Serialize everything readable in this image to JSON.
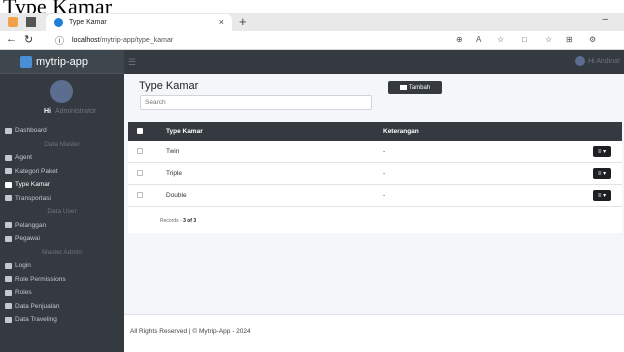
{
  "doc_title": "Type Kamar",
  "browser": {
    "tab_title": "Type Kamar",
    "tab_close": "×",
    "new_tab": "+",
    "window_min": "–",
    "url_host": "localhost",
    "url_path": "/mytrip-app/type_kamar"
  },
  "app": {
    "brand": "mytrip-app",
    "user_greeting": "Hi",
    "user_role": "Administrator",
    "top_user": "Hi Andina!"
  },
  "sidebar": {
    "items": [
      {
        "type": "item",
        "label": "Dashboard"
      },
      {
        "type": "header",
        "label": "Data Master"
      },
      {
        "type": "item",
        "label": "Agent"
      },
      {
        "type": "item",
        "label": "Kategori Paket"
      },
      {
        "type": "item",
        "label": "Type Kamar",
        "active": true
      },
      {
        "type": "item",
        "label": "Transportasi"
      },
      {
        "type": "header",
        "label": "Data User"
      },
      {
        "type": "item",
        "label": "Pelanggan"
      },
      {
        "type": "item",
        "label": "Pegawai"
      },
      {
        "type": "header",
        "label": "Master Admin"
      },
      {
        "type": "item",
        "label": "Login"
      },
      {
        "type": "item",
        "label": "Role Permissions"
      },
      {
        "type": "item",
        "label": "Roles"
      },
      {
        "type": "item",
        "label": "Data Penjualan"
      },
      {
        "type": "item",
        "label": "Data Traveling"
      }
    ]
  },
  "main": {
    "title": "Type Kamar",
    "search_placeholder": "Search",
    "add_button": "Tambah",
    "table": {
      "headers": [
        "Type Kamar",
        "Keterangan"
      ],
      "rows": [
        {
          "name": "Twin",
          "desc": "-",
          "action": "≡ ▾"
        },
        {
          "name": "Triple",
          "desc": "-",
          "action": "≡ ▾"
        },
        {
          "name": "Double",
          "desc": "-",
          "action": "≡ ▾"
        }
      ],
      "records_label": "Records - ",
      "records_value": "3 of 3"
    },
    "footer": "All Rights Reserved | © Mytrip-App - 2024"
  }
}
